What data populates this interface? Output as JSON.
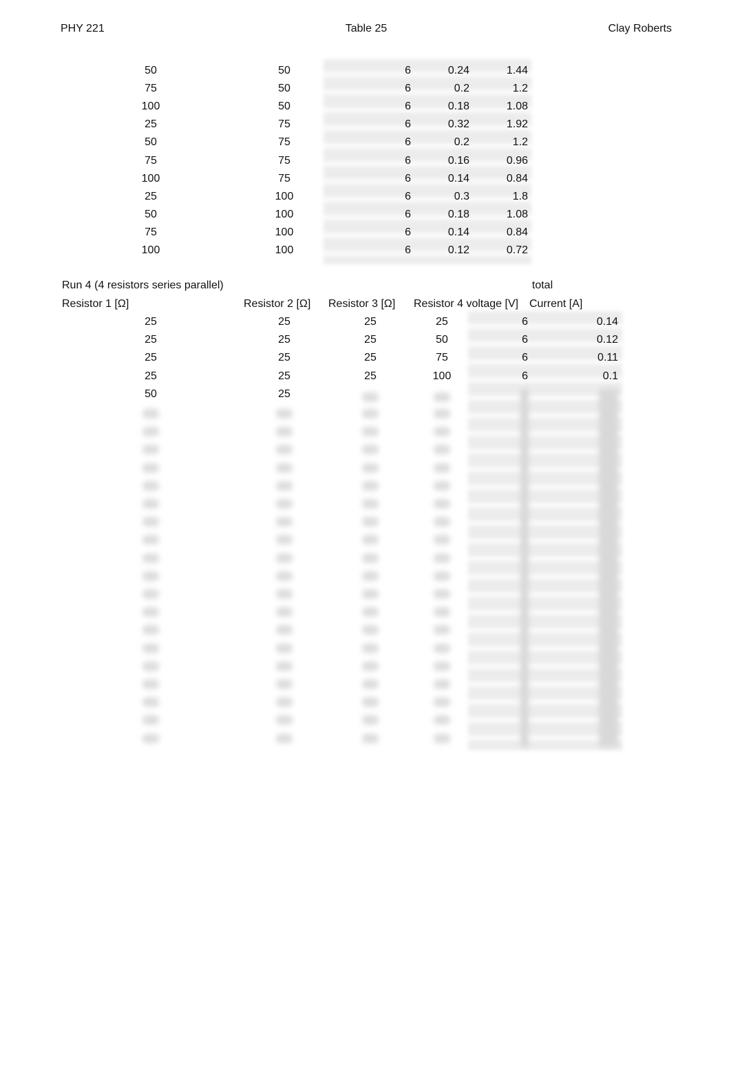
{
  "header": {
    "left": "PHY 221",
    "center": "Table 25",
    "right": "Clay Roberts"
  },
  "table_top": {
    "rows": [
      [
        "50",
        "50",
        "6",
        "0.24",
        "1.44"
      ],
      [
        "75",
        "50",
        "6",
        "0.2",
        "1.2"
      ],
      [
        "100",
        "50",
        "6",
        "0.18",
        "1.08"
      ],
      [
        "25",
        "75",
        "6",
        "0.32",
        "1.92"
      ],
      [
        "50",
        "75",
        "6",
        "0.2",
        "1.2"
      ],
      [
        "75",
        "75",
        "6",
        "0.16",
        "0.96"
      ],
      [
        "100",
        "75",
        "6",
        "0.14",
        "0.84"
      ],
      [
        "25",
        "100",
        "6",
        "0.3",
        "1.8"
      ],
      [
        "50",
        "100",
        "6",
        "0.18",
        "1.08"
      ],
      [
        "75",
        "100",
        "6",
        "0.14",
        "0.84"
      ],
      [
        "100",
        "100",
        "6",
        "0.12",
        "0.72"
      ]
    ]
  },
  "run4": {
    "title": "Run 4 (4 resistors series parallel)",
    "total_label": "total",
    "headers": [
      "Resistor 1 [Ω]",
      "Resistor 2 [Ω]",
      "Resistor 3 [Ω]",
      "Resistor 4 voltage [V]",
      "Current [A]"
    ],
    "rows": [
      [
        "25",
        "25",
        "25",
        "25",
        "6",
        "0.14"
      ],
      [
        "25",
        "25",
        "25",
        "50",
        "6",
        "0.12"
      ],
      [
        "25",
        "25",
        "25",
        "75",
        "6",
        "0.11"
      ],
      [
        "25",
        "25",
        "25",
        "100",
        "6",
        "0.1"
      ],
      [
        "50",
        "25",
        "",
        "",
        "",
        ""
      ]
    ]
  }
}
